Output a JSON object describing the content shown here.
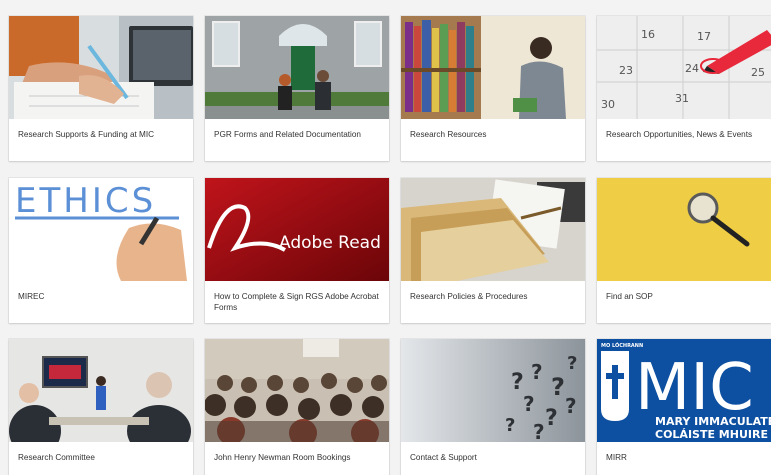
{
  "tiles": [
    {
      "label": "Research Supports & Funding at MIC",
      "image": "person-writing-at-laptop"
    },
    {
      "label": "PGR Forms and Related Documentation",
      "image": "students-outside-building"
    },
    {
      "label": "Research Resources",
      "image": "person-at-library-shelves"
    },
    {
      "label": "Research Opportunities, News & Events",
      "image": "calendar-with-marker"
    },
    {
      "label": "MIREC",
      "image": "hand-writing-ethics",
      "image_text": "ETHICS"
    },
    {
      "label": "How to Complete & Sign RGS Adobe Acrobat Forms",
      "image": "adobe-reader-logo",
      "image_text": "Adobe Read"
    },
    {
      "label": "Research Policies & Procedures",
      "image": "folders-and-documents"
    },
    {
      "label": "Find an SOP",
      "image": "magnifying-glass-on-yellow"
    },
    {
      "label": "Research Committee",
      "image": "meeting-presentation"
    },
    {
      "label": "John Henry Newman Room Bookings",
      "image": "seated-audience"
    },
    {
      "label": "Contact & Support",
      "image": "question-marks"
    },
    {
      "label": "MIRR",
      "image": "mic-logo",
      "image_text_top": "MO LÓCHRANN",
      "image_text_big": "MIC",
      "image_text_line1": "MARY IMMACULATE",
      "image_text_line2": "COLÁISTE MHUIRE GA"
    }
  ]
}
